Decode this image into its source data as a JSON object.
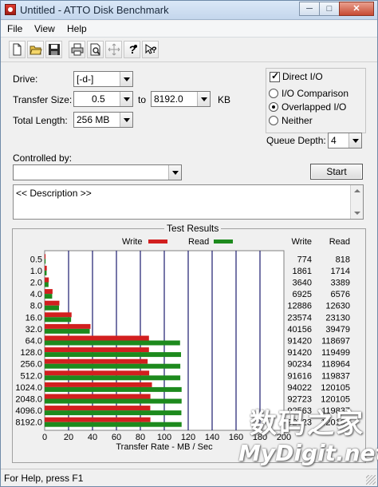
{
  "window": {
    "title": "Untitled - ATTO Disk Benchmark",
    "minimize": "─",
    "maximize": "□",
    "close": "✕"
  },
  "menu": {
    "items": [
      {
        "label": "File"
      },
      {
        "label": "View"
      },
      {
        "label": "Help"
      }
    ]
  },
  "toolbar": {
    "buttons": [
      "new-file-icon",
      "open-folder-icon",
      "save-icon",
      "print-icon",
      "print-preview-icon",
      "move-icon",
      "help-icon",
      "context-help-icon"
    ]
  },
  "form": {
    "drive_label": "Drive:",
    "drive_value": "[-d-]",
    "transfer_size_label": "Transfer Size:",
    "transfer_from": "0.5",
    "to_label": "to",
    "transfer_to": "8192.0",
    "kb_label": "KB",
    "total_length_label": "Total Length:",
    "total_length_value": "256 MB",
    "controlled_by_label": "Controlled by:",
    "controlled_by_value": "",
    "queue_depth_label": "Queue Depth:",
    "queue_depth_value": "4",
    "start_label": "Start",
    "description_text": "<< Description >>"
  },
  "options": {
    "direct_io_label": "Direct I/O",
    "direct_io_checked": true,
    "io_comparison_label": "I/O Comparison",
    "overlapped_io_label": "Overlapped I/O",
    "neither_label": "Neither",
    "selected": "overlapped"
  },
  "colors": {
    "write": "#d21f1f",
    "read": "#1d8a1d",
    "grid": "#1c1c6e"
  },
  "chart_data": {
    "type": "bar",
    "title": "Test Results",
    "legend": {
      "write": "Write",
      "read": "Read"
    },
    "xlabel": "Transfer Rate - MB / Sec",
    "xlim": [
      0,
      200
    ],
    "xticks": [
      "0",
      "20",
      "40",
      "60",
      "80",
      "100",
      "120",
      "140",
      "160",
      "180",
      "200"
    ],
    "categories": [
      "0.5",
      "1.0",
      "2.0",
      "4.0",
      "8.0",
      "16.0",
      "32.0",
      "64.0",
      "128.0",
      "256.0",
      "512.0",
      "1024.0",
      "2048.0",
      "4096.0",
      "8192.0"
    ],
    "series": [
      {
        "name": "Write",
        "values": [
          0.74,
          1.78,
          3.47,
          6.6,
          12.3,
          22.5,
          38.3,
          87.2,
          87.2,
          86.1,
          87.4,
          89.7,
          88.4,
          88.3,
          88.4
        ]
      },
      {
        "name": "Read",
        "values": [
          0.78,
          1.63,
          3.23,
          6.27,
          12.0,
          22.1,
          37.7,
          113.2,
          114.0,
          113.4,
          113.4,
          114.5,
          114.5,
          114.3,
          114.5
        ]
      }
    ],
    "table_headers": {
      "write": "Write",
      "read": "Read"
    },
    "write_raw": [
      "774",
      "1861",
      "3640",
      "6925",
      "12886",
      "23574",
      "40156",
      "91420",
      "91420",
      "90234",
      "91616",
      "94022",
      "92723",
      "92563",
      "92723"
    ],
    "read_raw": [
      "818",
      "1714",
      "3389",
      "6576",
      "12630",
      "23130",
      "39479",
      "118697",
      "119499",
      "118964",
      "119837",
      "120105",
      "120105",
      "119837",
      "120105"
    ],
    "grid": true,
    "legend_position": "top"
  },
  "status": {
    "text": "For Help, press F1"
  },
  "watermark": {
    "line1": "数码之家",
    "line2": "MyDigit.net"
  }
}
